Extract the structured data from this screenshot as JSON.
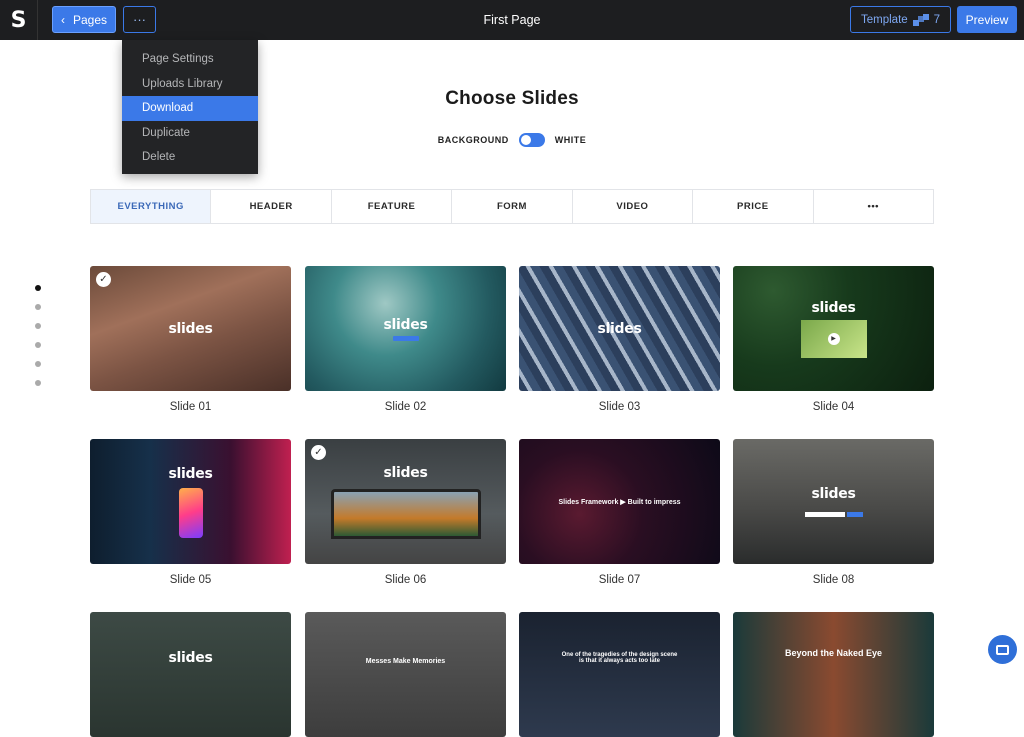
{
  "header": {
    "logo": "S",
    "pages_label": "Pages",
    "more_label": "···",
    "title": "First Page",
    "template_label": "Template",
    "template_count": "7",
    "preview_label": "Preview"
  },
  "dropdown": {
    "items": [
      "Page Settings",
      "Uploads Library",
      "Download",
      "Duplicate",
      "Delete"
    ],
    "active": "Download"
  },
  "main": {
    "headline": "Choose Slides",
    "toggle_left": "BACKGROUND",
    "toggle_right": "WHITE"
  },
  "tabs": [
    "EVERYTHING",
    "HEADER",
    "FEATURE",
    "FORM",
    "VIDEO",
    "PRICE",
    "•••"
  ],
  "active_tab": "EVERYTHING",
  "slides": [
    {
      "caption": "Slide 01",
      "word": "slides",
      "checked": true
    },
    {
      "caption": "Slide 02",
      "word": "slides",
      "checked": false
    },
    {
      "caption": "Slide 03",
      "word": "slides",
      "checked": false
    },
    {
      "caption": "Slide 04",
      "word": "slides",
      "checked": false
    },
    {
      "caption": "Slide 05",
      "word": "slides",
      "checked": false
    },
    {
      "caption": "Slide 06",
      "word": "slides",
      "checked": true
    },
    {
      "caption": "Slide 07",
      "word": "Slides Framework  ▶  Built to impress",
      "checked": false
    },
    {
      "caption": "Slide 08",
      "word": "slides",
      "checked": false
    },
    {
      "caption": "",
      "word": "slides",
      "checked": false
    },
    {
      "caption": "",
      "word": "Messes Make Memories",
      "checked": false
    },
    {
      "caption": "",
      "word": "One of the tragedies of the design scene is that it always acts too late",
      "checked": false
    },
    {
      "caption": "",
      "word": "Beyond the Naked Eye",
      "checked": false
    }
  ],
  "colors": {
    "topbar": "#1d1e20",
    "accent": "#3b79e8"
  }
}
